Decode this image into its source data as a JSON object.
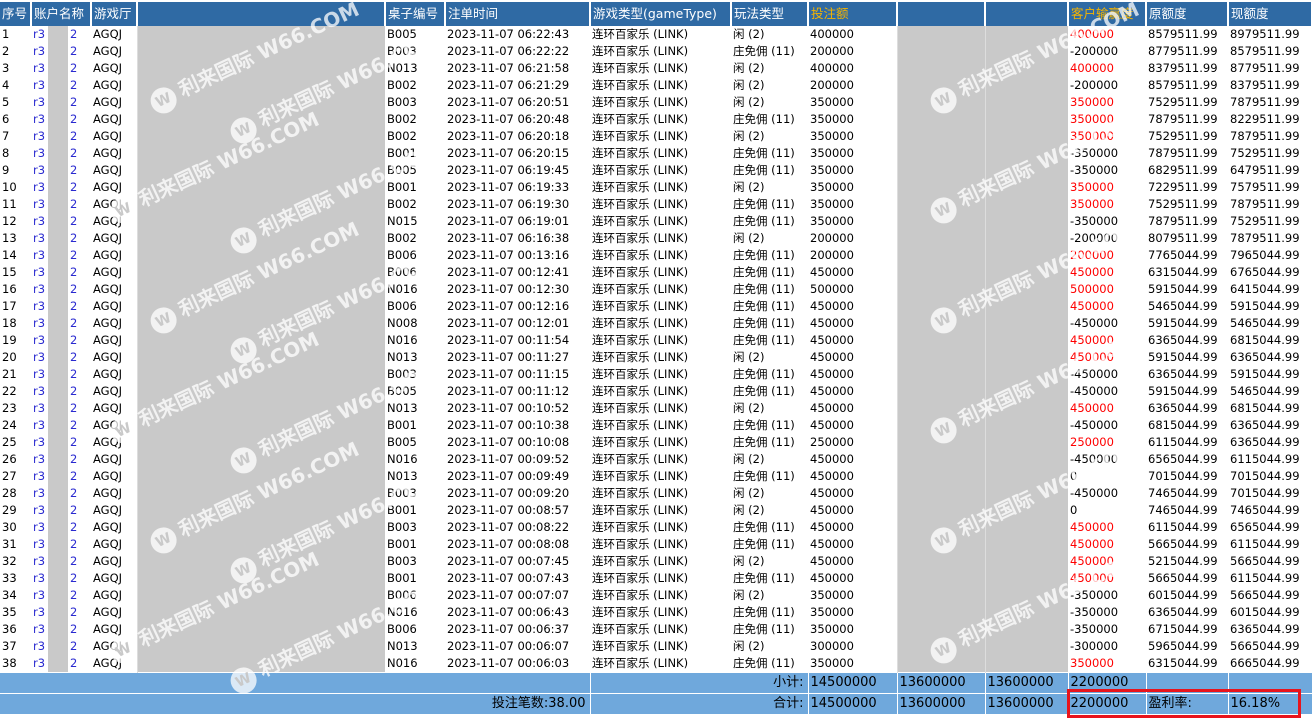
{
  "headers": [
    "序号",
    "账户名称",
    "游戏厅",
    "",
    "桌子编号",
    "注单时间",
    "游戏类型(gameType)",
    "玩法类型",
    "投注额",
    "",
    "",
    "客户输赢度",
    "原额度",
    "现额度"
  ],
  "account_prefix": "r3",
  "account_suffix": "2",
  "hall": "AGQJ",
  "game_type": "连环百家乐 (LINK)",
  "watermark": "利来国际 W66.COM",
  "colors": {
    "header_bg": "#2f6aa4",
    "header_gold": "#f5b400",
    "footer_bg": "#6fa8dc",
    "win": "#ff0000",
    "highlight_box": "#e8141c"
  },
  "rows": [
    [
      "1",
      "B005",
      "2023-11-07 06:22:43",
      "闲 (2)",
      "400000",
      "400000",
      "8579511.99",
      "8979511.99"
    ],
    [
      "2",
      "B003",
      "2023-11-07 06:22:22",
      "庄免佣 (11)",
      "200000",
      "-200000",
      "8779511.99",
      "8579511.99"
    ],
    [
      "3",
      "N013",
      "2023-11-07 06:21:58",
      "闲 (2)",
      "400000",
      "400000",
      "8379511.99",
      "8779511.99"
    ],
    [
      "4",
      "B002",
      "2023-11-07 06:21:29",
      "闲 (2)",
      "200000",
      "-200000",
      "8579511.99",
      "8379511.99"
    ],
    [
      "5",
      "B003",
      "2023-11-07 06:20:51",
      "闲 (2)",
      "350000",
      "350000",
      "7529511.99",
      "7879511.99"
    ],
    [
      "6",
      "B002",
      "2023-11-07 06:20:48",
      "庄免佣 (11)",
      "350000",
      "350000",
      "7879511.99",
      "8229511.99"
    ],
    [
      "7",
      "B002",
      "2023-11-07 06:20:18",
      "闲 (2)",
      "350000",
      "350000",
      "7529511.99",
      "7879511.99"
    ],
    [
      "8",
      "B001",
      "2023-11-07 06:20:15",
      "庄免佣 (11)",
      "350000",
      "-350000",
      "7879511.99",
      "7529511.99"
    ],
    [
      "9",
      "B005",
      "2023-11-07 06:19:45",
      "庄免佣 (11)",
      "350000",
      "-350000",
      "6829511.99",
      "6479511.99"
    ],
    [
      "10",
      "B001",
      "2023-11-07 06:19:33",
      "闲 (2)",
      "350000",
      "350000",
      "7229511.99",
      "7579511.99"
    ],
    [
      "11",
      "B002",
      "2023-11-07 06:19:30",
      "庄免佣 (11)",
      "350000",
      "350000",
      "7529511.99",
      "7879511.99"
    ],
    [
      "12",
      "N015",
      "2023-11-07 06:19:01",
      "庄免佣 (11)",
      "350000",
      "-350000",
      "7879511.99",
      "7529511.99"
    ],
    [
      "13",
      "B002",
      "2023-11-07 06:16:38",
      "闲 (2)",
      "200000",
      "-200000",
      "8079511.99",
      "7879511.99"
    ],
    [
      "14",
      "B006",
      "2023-11-07 00:13:16",
      "庄免佣 (11)",
      "200000",
      "200000",
      "7765044.99",
      "7965044.99"
    ],
    [
      "15",
      "B006",
      "2023-11-07 00:12:41",
      "庄免佣 (11)",
      "450000",
      "450000",
      "6315044.99",
      "6765044.99"
    ],
    [
      "16",
      "N016",
      "2023-11-07 00:12:30",
      "庄免佣 (11)",
      "500000",
      "500000",
      "5915044.99",
      "6415044.99"
    ],
    [
      "17",
      "B006",
      "2023-11-07 00:12:16",
      "庄免佣 (11)",
      "450000",
      "450000",
      "5465044.99",
      "5915044.99"
    ],
    [
      "18",
      "N008",
      "2023-11-07 00:12:01",
      "庄免佣 (11)",
      "450000",
      "-450000",
      "5915044.99",
      "5465044.99"
    ],
    [
      "19",
      "N016",
      "2023-11-07 00:11:54",
      "庄免佣 (11)",
      "450000",
      "450000",
      "6365044.99",
      "6815044.99"
    ],
    [
      "20",
      "N013",
      "2023-11-07 00:11:27",
      "闲 (2)",
      "450000",
      "450000",
      "5915044.99",
      "6365044.99"
    ],
    [
      "21",
      "B003",
      "2023-11-07 00:11:15",
      "庄免佣 (11)",
      "450000",
      "-450000",
      "6365044.99",
      "5915044.99"
    ],
    [
      "22",
      "B005",
      "2023-11-07 00:11:12",
      "庄免佣 (11)",
      "450000",
      "-450000",
      "5915044.99",
      "5465044.99"
    ],
    [
      "23",
      "N013",
      "2023-11-07 00:10:52",
      "闲 (2)",
      "450000",
      "450000",
      "6365044.99",
      "6815044.99"
    ],
    [
      "24",
      "B001",
      "2023-11-07 00:10:38",
      "庄免佣 (11)",
      "450000",
      "-450000",
      "6815044.99",
      "6365044.99"
    ],
    [
      "25",
      "B005",
      "2023-11-07 00:10:08",
      "庄免佣 (11)",
      "250000",
      "250000",
      "6115044.99",
      "6365044.99"
    ],
    [
      "26",
      "N016",
      "2023-11-07 00:09:52",
      "闲 (2)",
      "450000",
      "-450000",
      "6565044.99",
      "6115044.99"
    ],
    [
      "27",
      "N013",
      "2023-11-07 00:09:49",
      "庄免佣 (11)",
      "450000",
      "0",
      "7015044.99",
      "7015044.99"
    ],
    [
      "28",
      "B003",
      "2023-11-07 00:09:20",
      "闲 (2)",
      "450000",
      "-450000",
      "7465044.99",
      "7015044.99"
    ],
    [
      "29",
      "B001",
      "2023-11-07 00:08:57",
      "闲 (2)",
      "450000",
      "0",
      "7465044.99",
      "7465044.99"
    ],
    [
      "30",
      "B003",
      "2023-11-07 00:08:22",
      "庄免佣 (11)",
      "450000",
      "450000",
      "6115044.99",
      "6565044.99"
    ],
    [
      "31",
      "B001",
      "2023-11-07 00:08:08",
      "庄免佣 (11)",
      "450000",
      "450000",
      "5665044.99",
      "6115044.99"
    ],
    [
      "32",
      "B003",
      "2023-11-07 00:07:45",
      "闲 (2)",
      "450000",
      "450000",
      "5215044.99",
      "5665044.99"
    ],
    [
      "33",
      "B001",
      "2023-11-07 00:07:43",
      "庄免佣 (11)",
      "450000",
      "450000",
      "5665044.99",
      "6115044.99"
    ],
    [
      "34",
      "B006",
      "2023-11-07 00:07:07",
      "闲 (2)",
      "350000",
      "-350000",
      "6015044.99",
      "5665044.99"
    ],
    [
      "35",
      "N016",
      "2023-11-07 00:06:43",
      "庄免佣 (11)",
      "350000",
      "-350000",
      "6365044.99",
      "6015044.99"
    ],
    [
      "36",
      "B006",
      "2023-11-07 00:06:37",
      "庄免佣 (11)",
      "350000",
      "-350000",
      "6715044.99",
      "6365044.99"
    ],
    [
      "37",
      "N013",
      "2023-11-07 00:06:07",
      "闲 (2)",
      "300000",
      "-300000",
      "5965044.99",
      "5665044.99"
    ],
    [
      "38",
      "N016",
      "2023-11-07 00:06:03",
      "庄免佣 (11)",
      "350000",
      "350000",
      "6315044.99",
      "6665044.99"
    ]
  ],
  "subtotal": {
    "label": "小计:",
    "bet": "14500000",
    "col2": "13600000",
    "col3": "13600000",
    "winloss": "2200000"
  },
  "total": {
    "count_label": "投注笔数:38.00",
    "label": "合计:",
    "bet": "14500000",
    "col2": "13600000",
    "col3": "13600000",
    "winloss": "2200000",
    "profit_label": "盈利率:",
    "profit_rate": "16.18%"
  }
}
